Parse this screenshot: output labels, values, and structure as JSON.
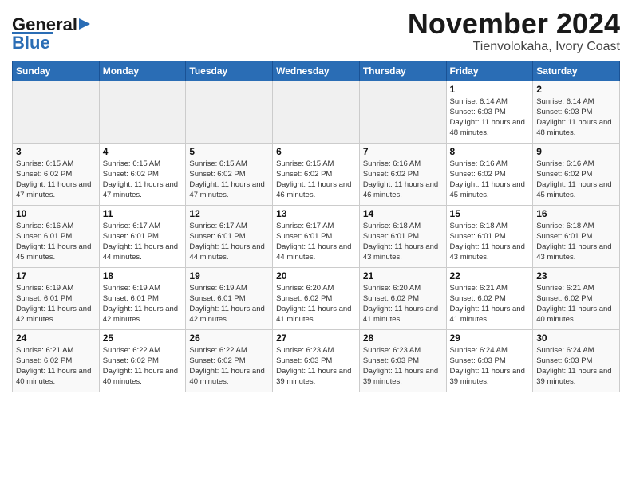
{
  "header": {
    "logo_line1": "General",
    "logo_line2": "Blue",
    "title": "November 2024",
    "subtitle": "Tienvolokaha, Ivory Coast"
  },
  "weekdays": [
    "Sunday",
    "Monday",
    "Tuesday",
    "Wednesday",
    "Thursday",
    "Friday",
    "Saturday"
  ],
  "weeks": [
    [
      {
        "day": "",
        "info": ""
      },
      {
        "day": "",
        "info": ""
      },
      {
        "day": "",
        "info": ""
      },
      {
        "day": "",
        "info": ""
      },
      {
        "day": "",
        "info": ""
      },
      {
        "day": "1",
        "info": "Sunrise: 6:14 AM\nSunset: 6:03 PM\nDaylight: 11 hours and 48 minutes."
      },
      {
        "day": "2",
        "info": "Sunrise: 6:14 AM\nSunset: 6:03 PM\nDaylight: 11 hours and 48 minutes."
      }
    ],
    [
      {
        "day": "3",
        "info": "Sunrise: 6:15 AM\nSunset: 6:02 PM\nDaylight: 11 hours and 47 minutes."
      },
      {
        "day": "4",
        "info": "Sunrise: 6:15 AM\nSunset: 6:02 PM\nDaylight: 11 hours and 47 minutes."
      },
      {
        "day": "5",
        "info": "Sunrise: 6:15 AM\nSunset: 6:02 PM\nDaylight: 11 hours and 47 minutes."
      },
      {
        "day": "6",
        "info": "Sunrise: 6:15 AM\nSunset: 6:02 PM\nDaylight: 11 hours and 46 minutes."
      },
      {
        "day": "7",
        "info": "Sunrise: 6:16 AM\nSunset: 6:02 PM\nDaylight: 11 hours and 46 minutes."
      },
      {
        "day": "8",
        "info": "Sunrise: 6:16 AM\nSunset: 6:02 PM\nDaylight: 11 hours and 45 minutes."
      },
      {
        "day": "9",
        "info": "Sunrise: 6:16 AM\nSunset: 6:02 PM\nDaylight: 11 hours and 45 minutes."
      }
    ],
    [
      {
        "day": "10",
        "info": "Sunrise: 6:16 AM\nSunset: 6:01 PM\nDaylight: 11 hours and 45 minutes."
      },
      {
        "day": "11",
        "info": "Sunrise: 6:17 AM\nSunset: 6:01 PM\nDaylight: 11 hours and 44 minutes."
      },
      {
        "day": "12",
        "info": "Sunrise: 6:17 AM\nSunset: 6:01 PM\nDaylight: 11 hours and 44 minutes."
      },
      {
        "day": "13",
        "info": "Sunrise: 6:17 AM\nSunset: 6:01 PM\nDaylight: 11 hours and 44 minutes."
      },
      {
        "day": "14",
        "info": "Sunrise: 6:18 AM\nSunset: 6:01 PM\nDaylight: 11 hours and 43 minutes."
      },
      {
        "day": "15",
        "info": "Sunrise: 6:18 AM\nSunset: 6:01 PM\nDaylight: 11 hours and 43 minutes."
      },
      {
        "day": "16",
        "info": "Sunrise: 6:18 AM\nSunset: 6:01 PM\nDaylight: 11 hours and 43 minutes."
      }
    ],
    [
      {
        "day": "17",
        "info": "Sunrise: 6:19 AM\nSunset: 6:01 PM\nDaylight: 11 hours and 42 minutes."
      },
      {
        "day": "18",
        "info": "Sunrise: 6:19 AM\nSunset: 6:01 PM\nDaylight: 11 hours and 42 minutes."
      },
      {
        "day": "19",
        "info": "Sunrise: 6:19 AM\nSunset: 6:01 PM\nDaylight: 11 hours and 42 minutes."
      },
      {
        "day": "20",
        "info": "Sunrise: 6:20 AM\nSunset: 6:02 PM\nDaylight: 11 hours and 41 minutes."
      },
      {
        "day": "21",
        "info": "Sunrise: 6:20 AM\nSunset: 6:02 PM\nDaylight: 11 hours and 41 minutes."
      },
      {
        "day": "22",
        "info": "Sunrise: 6:21 AM\nSunset: 6:02 PM\nDaylight: 11 hours and 41 minutes."
      },
      {
        "day": "23",
        "info": "Sunrise: 6:21 AM\nSunset: 6:02 PM\nDaylight: 11 hours and 40 minutes."
      }
    ],
    [
      {
        "day": "24",
        "info": "Sunrise: 6:21 AM\nSunset: 6:02 PM\nDaylight: 11 hours and 40 minutes."
      },
      {
        "day": "25",
        "info": "Sunrise: 6:22 AM\nSunset: 6:02 PM\nDaylight: 11 hours and 40 minutes."
      },
      {
        "day": "26",
        "info": "Sunrise: 6:22 AM\nSunset: 6:02 PM\nDaylight: 11 hours and 40 minutes."
      },
      {
        "day": "27",
        "info": "Sunrise: 6:23 AM\nSunset: 6:03 PM\nDaylight: 11 hours and 39 minutes."
      },
      {
        "day": "28",
        "info": "Sunrise: 6:23 AM\nSunset: 6:03 PM\nDaylight: 11 hours and 39 minutes."
      },
      {
        "day": "29",
        "info": "Sunrise: 6:24 AM\nSunset: 6:03 PM\nDaylight: 11 hours and 39 minutes."
      },
      {
        "day": "30",
        "info": "Sunrise: 6:24 AM\nSunset: 6:03 PM\nDaylight: 11 hours and 39 minutes."
      }
    ]
  ]
}
